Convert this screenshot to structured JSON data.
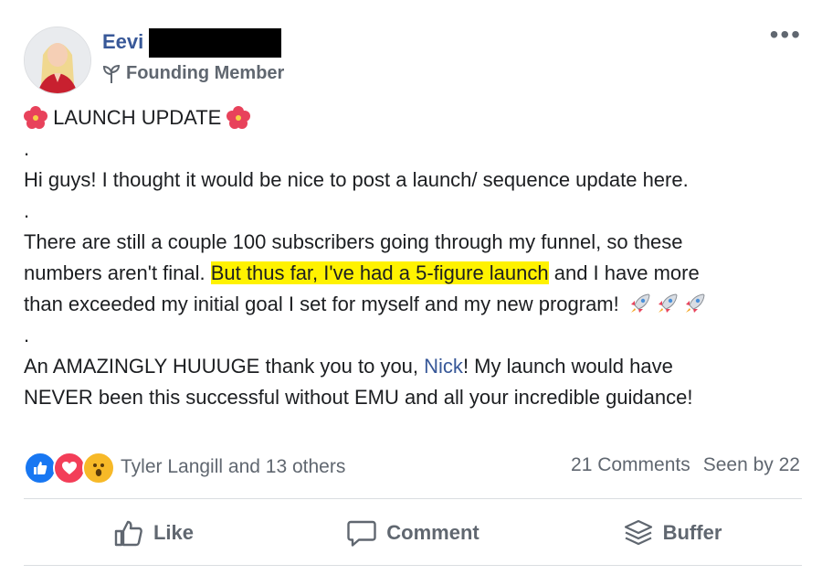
{
  "author": {
    "first_name": "Eevi",
    "badge": "Founding Member"
  },
  "menu": {
    "more_label": "•••"
  },
  "post": {
    "title": "LAUNCH UPDATE",
    "separator": ".",
    "line1": "Hi guys! I thought it would be nice to post a launch/ sequence update here.",
    "p2_line1": "There are still a couple 100 subscribers going through my funnel, so these",
    "p2_line2_start": "numbers aren't final. ",
    "p2_highlight": "But thus far, I've had a 5-figure launch",
    "p2_line2_end": " and I have more",
    "p2_line3": "than exceeded my initial goal I set for myself and my new program!",
    "p3_start": "An AMAZINGLY HUUUGE thank you to you, ",
    "p3_mention": "Nick",
    "p3_end": "! My launch would have",
    "p3_line2": "NEVER been this successful without EMU and all your incredible guidance!"
  },
  "reactions": {
    "types": [
      "like",
      "love",
      "wow"
    ],
    "reactors_text": "Tyler Langill and 13 others",
    "comments_text": "21 Comments",
    "seen_text": "Seen by 22"
  },
  "actions": {
    "like_label": "Like",
    "comment_label": "Comment",
    "buffer_label": "Buffer"
  },
  "colors": {
    "link_blue": "#385898",
    "highlight": "#fff200",
    "like_blue": "#1877f2",
    "love_red": "#f33e58",
    "wow_yellow": "#f7b928"
  }
}
